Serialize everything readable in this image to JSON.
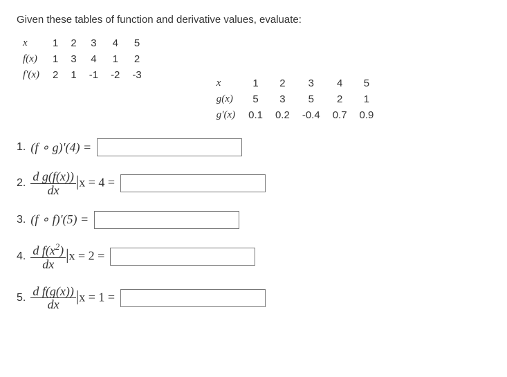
{
  "prompt": "Given these tables of function and derivative values, evaluate:",
  "table1": {
    "x_label": "x",
    "fx_label": "f(x)",
    "fprime_label": "f'(x)",
    "x": [
      "1",
      "2",
      "3",
      "4",
      "5"
    ],
    "fx": [
      "1",
      "3",
      "4",
      "1",
      "2"
    ],
    "fprime": [
      "2",
      "1",
      "-1",
      "-2",
      "-3"
    ]
  },
  "table2": {
    "x_label": "x",
    "gx_label": "g(x)",
    "gprime_label": "g'(x)",
    "x": [
      "1",
      "2",
      "3",
      "4",
      "5"
    ],
    "gx": [
      "5",
      "3",
      "5",
      "2",
      "1"
    ],
    "gprime": [
      "0.1",
      "0.2",
      "-0.4",
      "0.7",
      "0.9"
    ]
  },
  "questions": {
    "q1": {
      "num": "1.",
      "expr_lead": "(f ∘ g)'(4) = "
    },
    "q2": {
      "num": "2.",
      "frac_num": "d g(f(x))",
      "frac_den": "dx",
      "evalbar": "|",
      "evaltext": "x = 4  = "
    },
    "q3": {
      "num": "3.",
      "expr_lead": "(f ∘ f)'(5) = "
    },
    "q4": {
      "num": "4.",
      "frac_num_lead": "d f(x",
      "frac_num_sup": "2",
      "frac_num_tail": ")",
      "frac_den": "dx",
      "evalbar": "|",
      "evaltext": "x = 2  = "
    },
    "q5": {
      "num": "5.",
      "frac_num": "d f(g(x))",
      "frac_den": "dx",
      "evalbar": "|",
      "evaltext": "x = 1  = "
    }
  },
  "chart_data": [
    {
      "type": "table",
      "title": "f table",
      "categories": [
        1,
        2,
        3,
        4,
        5
      ],
      "series": [
        {
          "name": "f(x)",
          "values": [
            1,
            3,
            4,
            1,
            2
          ]
        },
        {
          "name": "f'(x)",
          "values": [
            2,
            1,
            -1,
            -2,
            -3
          ]
        }
      ]
    },
    {
      "type": "table",
      "title": "g table",
      "categories": [
        1,
        2,
        3,
        4,
        5
      ],
      "series": [
        {
          "name": "g(x)",
          "values": [
            5,
            3,
            5,
            2,
            1
          ]
        },
        {
          "name": "g'(x)",
          "values": [
            0.1,
            0.2,
            -0.4,
            0.7,
            0.9
          ]
        }
      ]
    }
  ]
}
